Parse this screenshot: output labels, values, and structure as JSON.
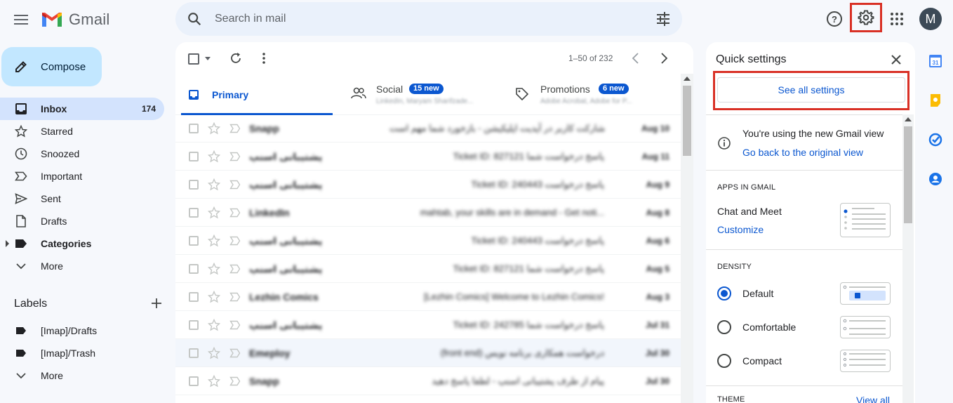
{
  "app": {
    "name": "Gmail"
  },
  "search": {
    "placeholder": "Search in mail"
  },
  "account": {
    "initial": "M"
  },
  "compose": {
    "label": "Compose"
  },
  "nav": {
    "items": [
      {
        "label": "Inbox",
        "count": "174"
      },
      {
        "label": "Starred"
      },
      {
        "label": "Snoozed"
      },
      {
        "label": "Important"
      },
      {
        "label": "Sent"
      },
      {
        "label": "Drafts"
      },
      {
        "label": "Categories"
      },
      {
        "label": "More"
      }
    ]
  },
  "labels": {
    "title": "Labels",
    "items": [
      {
        "label": "[Imap]/Drafts"
      },
      {
        "label": "[Imap]/Trash"
      },
      {
        "label": "More"
      }
    ]
  },
  "toolbar": {
    "range": "1–50 of 232"
  },
  "tabs": [
    {
      "label": "Primary"
    },
    {
      "label": "Social",
      "badge": "15 new",
      "snippet": "LinkedIn, Maryam Sharifzade..."
    },
    {
      "label": "Promotions",
      "badge": "6 new",
      "snippet": "Adobe Acrobat, Adobe for P..."
    }
  ],
  "mails": [
    {
      "sender": "Snapp",
      "subject": "مشارکت کاربر در آپدیت اپلیکیشن - بازخورد شما مهم است",
      "date": "Aug 10"
    },
    {
      "sender": "پشتیبانی اسنپ",
      "subject": "Ticket ID: 827121 پاسخ درخواست شما",
      "date": "Aug 11"
    },
    {
      "sender": "پشتیبانی اسنپ",
      "subject": "Ticket ID: 240443 پاسخ درخواست",
      "date": "Aug 9"
    },
    {
      "sender": "LinkedIn",
      "subject": "mahtab, your skills are in demand - Get noti...",
      "date": "Aug 8"
    },
    {
      "sender": "پشتیبانی اسنپ",
      "subject": "Ticket ID: 240443 پاسخ درخواست",
      "date": "Aug 6"
    },
    {
      "sender": "پشتیبانی اسنپ",
      "subject": "Ticket ID: 827121 پاسخ درخواست شما",
      "date": "Aug 5"
    },
    {
      "sender": "Lezhin Comics",
      "subject": "[Lezhin Comics] Welcome to Lezhin Comics!",
      "date": "Aug 3"
    },
    {
      "sender": "پشتیبانی اسنپ",
      "subject": "Ticket ID: 242785 پاسخ درخواست شما",
      "date": "Jul 31"
    },
    {
      "sender": "Emeploy",
      "subject": "(front end) درخواست همکاری برنامه نویس",
      "date": "Jul 30"
    },
    {
      "sender": "Snapp",
      "subject": "پیام از طرف پشتیبانی اسنپ - لطفا پاسخ دهید",
      "date": "Jul 30"
    }
  ],
  "quick_settings": {
    "title": "Quick settings",
    "see_all": "See all settings",
    "info_text": "You're using the new Gmail view",
    "info_link": "Go back to the original view",
    "apps_heading": "APPS IN GMAIL",
    "chat_label": "Chat and Meet",
    "customize": "Customize",
    "density_heading": "DENSITY",
    "density_options": [
      {
        "label": "Default",
        "selected": true
      },
      {
        "label": "Comfortable",
        "selected": false
      },
      {
        "label": "Compact",
        "selected": false
      }
    ],
    "theme_heading": "THEME",
    "theme_view_all": "View all"
  },
  "colors": {
    "accent": "#0b57d0",
    "highlight_box": "#d93025",
    "compose_bg": "#c2e7ff",
    "active_nav": "#d3e3fd"
  }
}
